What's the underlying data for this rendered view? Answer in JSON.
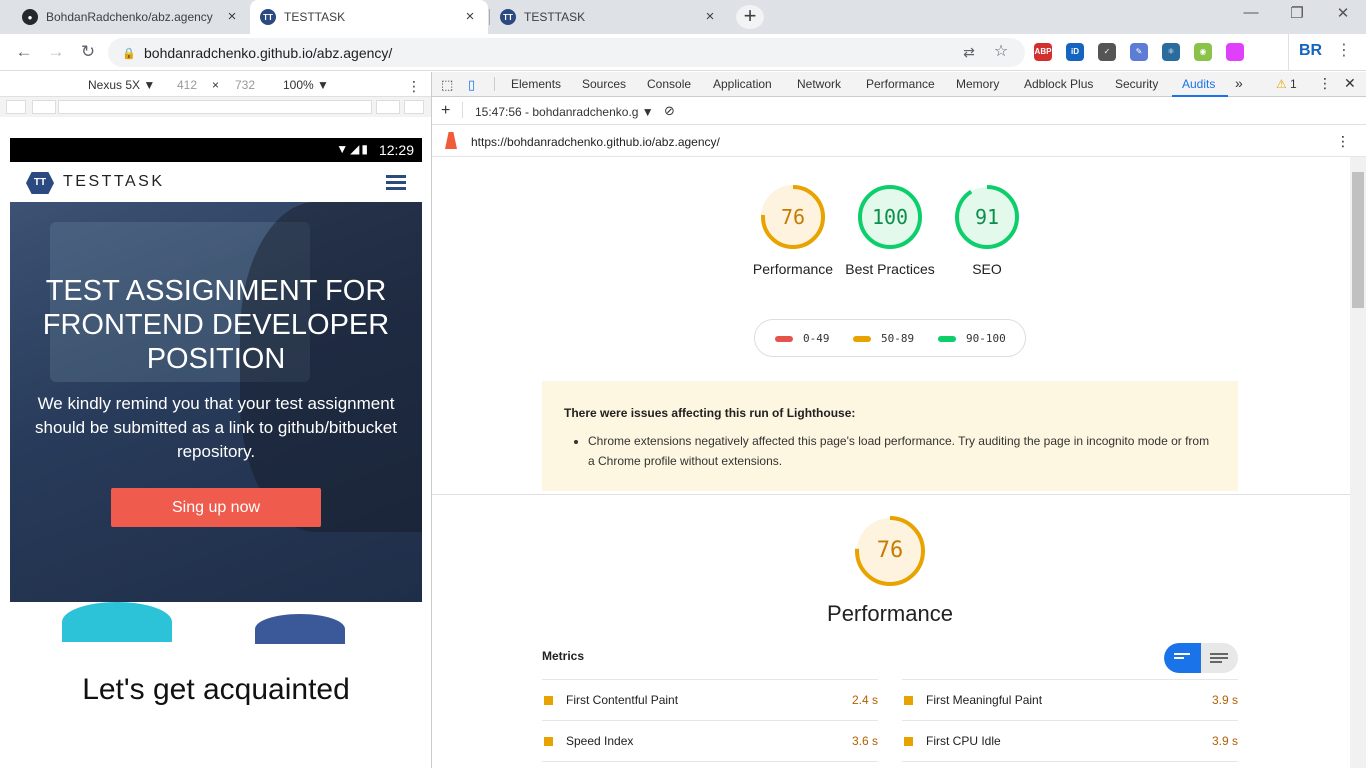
{
  "browser": {
    "tabs": [
      {
        "title": "BohdanRadchenko/abz.agency"
      },
      {
        "title": "TESTTASK"
      },
      {
        "title": "TESTTASK"
      }
    ],
    "new_tab": "+",
    "url": "bohdanradchenko.github.io/abz.agency/",
    "window_controls": {
      "minimize": "—",
      "restore": "❐",
      "close": "✕"
    },
    "profile_initials": "BR",
    "extensions": [
      {
        "name": "abp-icon",
        "label": "ABP",
        "color": "#d32f2f"
      },
      {
        "name": "id-icon",
        "label": "iD",
        "color": "#1565c0"
      },
      {
        "name": "check-icon",
        "label": "✓",
        "color": "#555555"
      },
      {
        "name": "pen-icon",
        "label": "✎",
        "color": "#5c7cd6"
      },
      {
        "name": "react-icon",
        "label": "⚛",
        "color": "#2b6c9e"
      },
      {
        "name": "color-icon",
        "label": "◉",
        "color": "#8bc34a"
      },
      {
        "name": "gradient-icon",
        "label": "",
        "color": "#e040fb"
      }
    ]
  },
  "device_toolbar": {
    "device": "Nexus 5X ▼",
    "width": "412",
    "times": "×",
    "height": "732",
    "zoom": "100% ▼"
  },
  "phone": {
    "time": "12:29",
    "logo_badge": "TT",
    "logo_text": "TESTTASK",
    "hero_title": "TEST ASSIGNMENT FOR FRONTEND DEVELOPER POSITION",
    "hero_text": "We kindly remind you that your test assignment should be submitted as a link to github/bitbucket repository.",
    "cta": "Sing up now",
    "section_title": "Let's get acquainted"
  },
  "devtools": {
    "tabs": [
      "Elements",
      "Sources",
      "Console",
      "Application",
      "Network",
      "Performance",
      "Memory",
      "Adblock Plus",
      "Security",
      "Audits"
    ],
    "active_tab": "Audits",
    "more": "»",
    "warnings_count": "1",
    "report_selector": "15:47:56 - bohdanradchenko.g ▼",
    "report_url": "https://bohdanradchenko.github.io/abz.agency/"
  },
  "lighthouse": {
    "scores": [
      {
        "value": 76,
        "label": "Performance",
        "color": "#e8a300"
      },
      {
        "value": 100,
        "label": "Best Practices",
        "color": "#0cce6b"
      },
      {
        "value": 91,
        "label": "SEO",
        "color": "#0cce6b"
      }
    ],
    "legend": [
      {
        "range": "0-49",
        "color": "#e5534b"
      },
      {
        "range": "50-89",
        "color": "#e8a300"
      },
      {
        "range": "90-100",
        "color": "#0cce6b"
      }
    ],
    "warning_title": "There were issues affecting this run of Lighthouse:",
    "warning_item": "Chrome extensions negatively affected this page's load performance. Try auditing the page in incognito mode or from a Chrome profile without extensions.",
    "performance_score": 76,
    "performance_title": "Performance",
    "metrics_title": "Metrics",
    "metrics": [
      {
        "label": "First Contentful Paint",
        "value": "2.4 s"
      },
      {
        "label": "First Meaningful Paint",
        "value": "3.9 s"
      },
      {
        "label": "Speed Index",
        "value": "3.6 s"
      },
      {
        "label": "First CPU Idle",
        "value": "3.9 s"
      }
    ]
  }
}
